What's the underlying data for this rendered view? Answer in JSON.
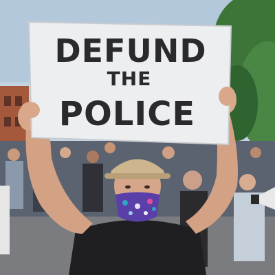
{
  "sign": {
    "line1": "DEFUND",
    "line2": "THE",
    "line3": "POLICE"
  },
  "colors": {
    "sky": "#c8d6e3",
    "trees": "#3f7a3c",
    "sign_board": "#eef0f2",
    "ink": "#2a2a2e",
    "shirt": "#1e1e20",
    "skin": "#d9a88a",
    "mask_pattern": "#6b3fb0"
  }
}
